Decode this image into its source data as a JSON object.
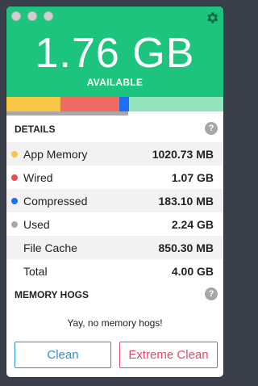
{
  "header": {
    "available_value": "1.76 GB",
    "available_label": "AVAILABLE",
    "bg_color": "#1dc47e"
  },
  "usage_bar": {
    "segments": [
      {
        "name": "app_memory",
        "fraction": 0.25,
        "color": "#f9c646"
      },
      {
        "name": "wired",
        "fraction": 0.27,
        "color": "#ef6a60"
      },
      {
        "name": "compressed",
        "fraction": 0.045,
        "color": "#1a6ff2"
      }
    ],
    "used_fraction": 0.56,
    "free_color": "#93e3bc"
  },
  "details": {
    "title": "DETAILS",
    "help": "?",
    "rows": [
      {
        "label": "App Memory",
        "value": "1020.73 MB",
        "color": "#f9c646"
      },
      {
        "label": "Wired",
        "value": "1.07 GB",
        "color": "#ef4a50"
      },
      {
        "label": "Compressed",
        "value": "183.10 MB",
        "color": "#1a6ff2"
      },
      {
        "label": "Used",
        "value": "2.24 GB",
        "color": "#a8a8a8"
      },
      {
        "label": "File Cache",
        "value": "850.30 MB",
        "color": ""
      },
      {
        "label": "Total",
        "value": "4.00 GB",
        "color": ""
      }
    ]
  },
  "memory_hogs": {
    "title": "MEMORY HOGS",
    "help": "?",
    "message": "Yay, no memory hogs!"
  },
  "buttons": {
    "clean": "Clean",
    "extreme_clean": "Extreme Clean"
  }
}
